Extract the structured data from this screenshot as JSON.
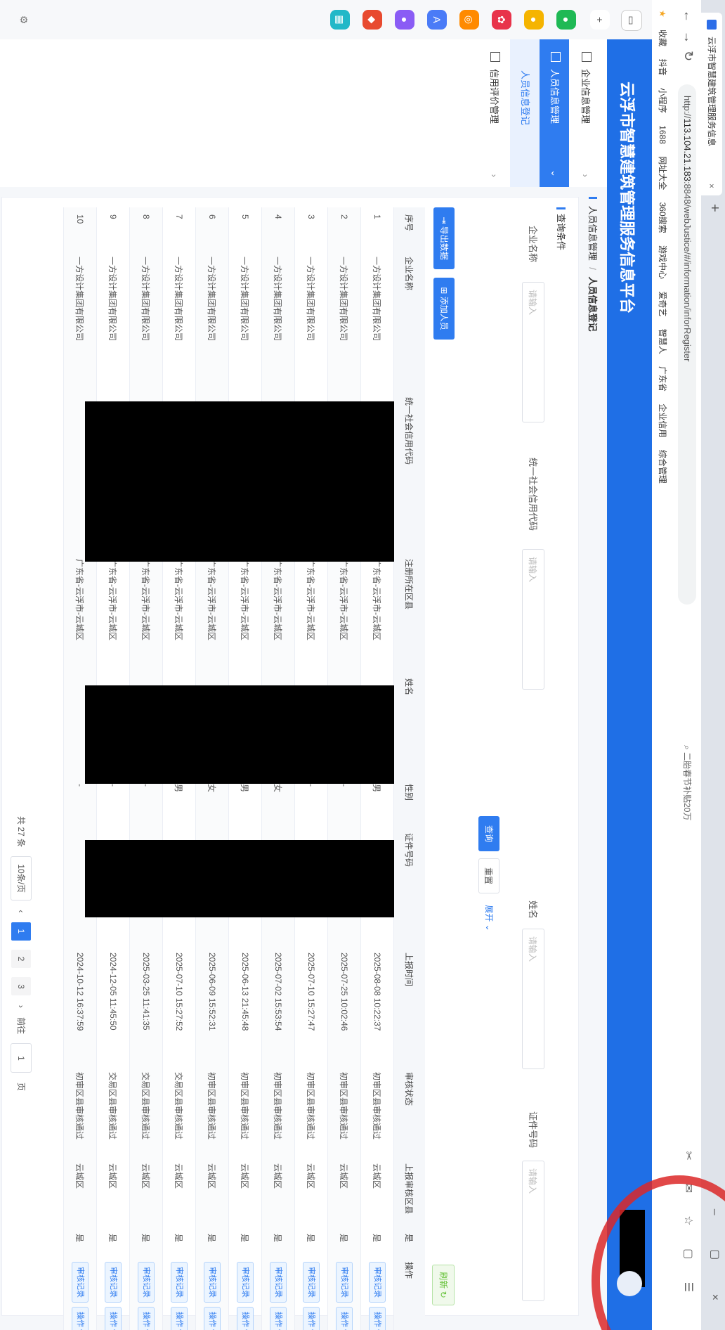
{
  "browser": {
    "tab_title": "云浮市智慧建筑管理服务信息",
    "tab_close": "×",
    "new_tab": "+",
    "url_prefix": "http://",
    "url_host": "113.104.21.183",
    "url_rest": ":8848/webJustice/#/information/inforRegister",
    "search_text": "二胎春节补贴20万",
    "bookmarks": [
      "收藏",
      "抖音",
      "小程序",
      "1688",
      "网址大全",
      "360搜索",
      "游戏中心",
      "爱奇艺",
      "智慧人",
      "广东省",
      "企业信用",
      "综合管理"
    ]
  },
  "app": {
    "title": "云浮市智慧建筑管理服务信息平台"
  },
  "sidebar": {
    "items": [
      {
        "label": "企业信息管理",
        "arrow": "›"
      },
      {
        "label": "人员信息管理",
        "arrow": "⌄"
      },
      {
        "label": "人员信息登记"
      },
      {
        "label": "信用评价管理",
        "arrow": "›"
      }
    ]
  },
  "breadcrumb": {
    "parent": "人员信息管理",
    "sep": "/",
    "current": "人员信息登记"
  },
  "query": {
    "title": "查询条件",
    "company_label": "企业名称",
    "company_placeholder": "请输入",
    "credit_label": "统一社会信用代码",
    "credit_placeholder": "请输入",
    "name_label": "姓名",
    "name_placeholder": "请输入",
    "idno_label": "证件号码",
    "idno_placeholder": "请输入",
    "search_btn": "查询",
    "reset_btn": "重置",
    "expand_btn": "展开 ⌄"
  },
  "toolbar": {
    "export_btn": "导出数据",
    "add_btn": "添加人员",
    "refresh_btn": "刷新"
  },
  "table": {
    "headers": [
      "序号",
      "企业名称",
      "统一社会信用代码",
      "注册所在区县",
      "姓名",
      "性别",
      "证件号码",
      "上报时间",
      "审核状态",
      "上报审核区县",
      "是",
      "操作"
    ],
    "rows": [
      {
        "no": "1",
        "company": "一方设计集团有限公司",
        "region": "广东省-云浮市-云城区",
        "gender": "男",
        "time": "2025-08-08 10:22:37",
        "status": "初审区县审核通过",
        "area": "云城区",
        "flag": "是"
      },
      {
        "no": "2",
        "company": "一方设计集团有限公司",
        "region": "广东省-云浮市-云城区",
        "gender": "-",
        "time": "2025-07-25 10:02:46",
        "status": "初审区县审核通过",
        "area": "云城区",
        "flag": "是"
      },
      {
        "no": "3",
        "company": "一方设计集团有限公司",
        "region": "广东省-云浮市-云城区",
        "gender": "-",
        "time": "2025-07-10 15:27:47",
        "status": "初审区县审核通过",
        "area": "云城区",
        "flag": "是"
      },
      {
        "no": "4",
        "company": "一方设计集团有限公司",
        "region": "广东省-云浮市-云城区",
        "gender": "女",
        "time": "2025-07-02 15:53:54",
        "status": "初审区县审核通过",
        "area": "云城区",
        "flag": "是"
      },
      {
        "no": "5",
        "company": "一方设计集团有限公司",
        "region": "广东省-云浮市-云城区",
        "gender": "男",
        "time": "2025-06-13 21:45:48",
        "status": "初审区县审核通过",
        "area": "云城区",
        "flag": "是"
      },
      {
        "no": "6",
        "company": "一方设计集团有限公司",
        "region": "广东省-云浮市-云城区",
        "gender": "女",
        "time": "2025-06-09 15:52:31",
        "status": "初审区县审核通过",
        "area": "云城区",
        "flag": "是"
      },
      {
        "no": "7",
        "company": "一方设计集团有限公司",
        "region": "广东省-云浮市-云城区",
        "gender": "男",
        "time": "2025-07-10 15:27:52",
        "status": "交易区县审核通过",
        "area": "云城区",
        "flag": "是"
      },
      {
        "no": "8",
        "company": "一方设计集团有限公司",
        "region": "广东省-云浮市-云城区",
        "gender": "-",
        "time": "2025-03-25 11:41:35",
        "status": "交易区县审核通过",
        "area": "云城区",
        "flag": "是"
      },
      {
        "no": "9",
        "company": "一方设计集团有限公司",
        "region": "广东省-云浮市-云城区",
        "gender": "-",
        "time": "2024-12-05 11:45:50",
        "status": "交易区县审核通过",
        "area": "云城区",
        "flag": "是"
      },
      {
        "no": "10",
        "company": "一方设计集团有限公司",
        "region": "广东省-云浮市-云城区",
        "gender": "-",
        "time": "2024-10-12 16:37:59",
        "status": "初审区县审核通过",
        "area": "云城区",
        "flag": "是"
      }
    ],
    "action_record": "审核记录",
    "action_more": "操作 ▾"
  },
  "pager": {
    "total": "共 27 条",
    "size": "10条/页",
    "pages": [
      "1",
      "2",
      "3"
    ],
    "jump_label": "前往",
    "jump_value": "1",
    "jump_suffix": "页"
  },
  "colors": {
    "primary": "#2f7cf0",
    "header": "#1f6fe6",
    "success": "#67c23a"
  }
}
